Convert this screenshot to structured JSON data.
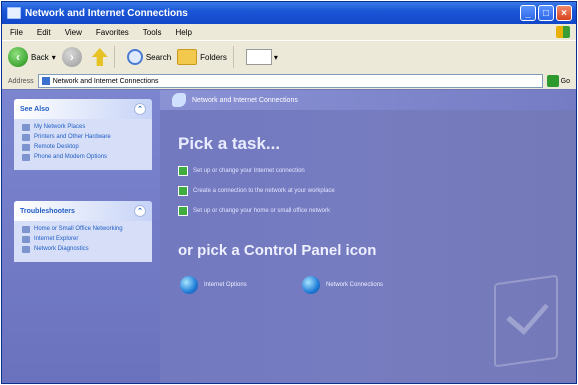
{
  "window": {
    "title": "Network and Internet Connections"
  },
  "menu": [
    "File",
    "Edit",
    "View",
    "Favorites",
    "Tools",
    "Help"
  ],
  "toolbar": {
    "back_label": "Back",
    "search_label": "Search",
    "folders_label": "Folders"
  },
  "address": {
    "label": "Address",
    "value": "Network and Internet Connections",
    "go_label": "Go"
  },
  "see_also": {
    "title": "See Also",
    "items": [
      "My Network Places",
      "Printers and Other Hardware",
      "Remote Desktop",
      "Phone and Modem Options"
    ]
  },
  "troubleshooters": {
    "title": "Troubleshooters",
    "items": [
      "Home or Small Office Networking",
      "Internet Explorer",
      "Network Diagnostics"
    ]
  },
  "main": {
    "header": "Network and Internet Connections",
    "pick_task": "Pick a task...",
    "tasks": [
      "Set up or change your Internet connection",
      "Create a connection to the network at your workplace",
      "Set up or change your home or small office network"
    ],
    "pick_icon": "or pick a Control Panel icon",
    "icons": [
      "Internet Options",
      "Network Connections"
    ]
  }
}
